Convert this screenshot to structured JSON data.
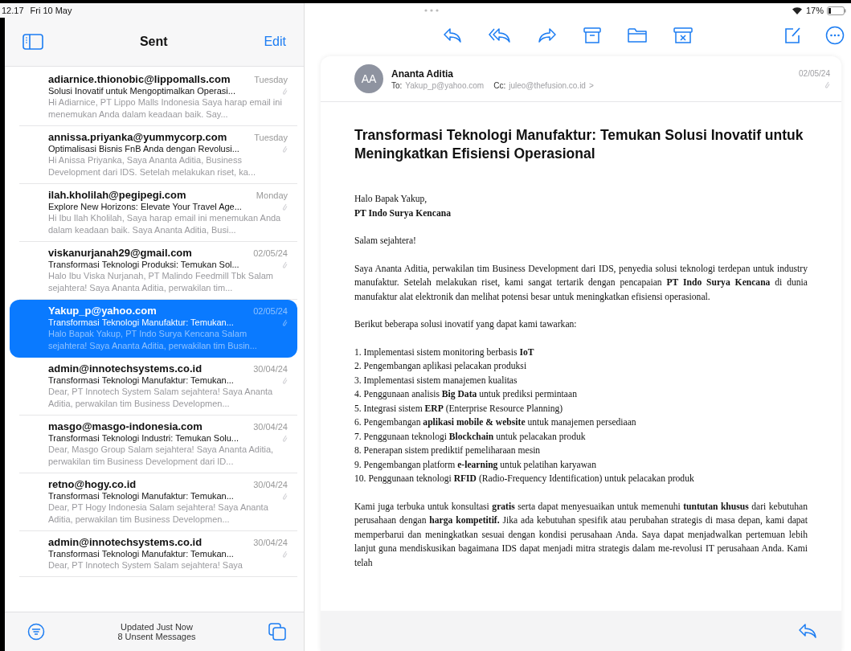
{
  "status_bar": {
    "time": "12.17",
    "date": "Fri 10 May",
    "battery": "17%"
  },
  "mailbox": {
    "title": "Sent",
    "edit": "Edit",
    "messages": [
      {
        "from": "adiarnice.thionobic@lippomalls.com",
        "date": "Tuesday",
        "subject": "Solusi Inovatif untuk Mengoptimalkan Operasi...",
        "preview": "Hi Adiarnice, PT Lippo Malls Indonesia Saya harap email ini menemukan Anda dalam keadaan baik. Say...",
        "selected": false
      },
      {
        "from": "annissa.priyanka@yummycorp.com",
        "date": "Tuesday",
        "subject": "Optimalisasi Bisnis FnB Anda dengan Revolusi...",
        "preview": "Hi Anissa Priyanka, Saya Ananta Aditia, Business Development dari IDS. Setelah melakukan riset, ka...",
        "selected": false
      },
      {
        "from": "ilah.kholilah@pegipegi.com",
        "date": "Monday",
        "subject": "Explore New Horizons: Elevate Your Travel Age...",
        "preview": "Hi Ibu Ilah Kholilah, Saya harap email ini menemukan Anda dalam keadaan baik. Saya Ananta Aditia, Busi...",
        "selected": false
      },
      {
        "from": "viskanurjanah29@gmail.com",
        "date": "02/05/24",
        "subject": "Transformasi Teknologi Produksi: Temukan Sol...",
        "preview": "Halo Ibu Viska Nurjanah, PT Malindo Feedmill Tbk Salam sejahtera! Saya Ananta Aditia, perwakilan tim...",
        "selected": false
      },
      {
        "from": "Yakup_p@yahoo.com",
        "date": "02/05/24",
        "subject": "Transformasi Teknologi Manufaktur: Temukan...",
        "preview": "Halo Bapak Yakup, PT Indo Surya Kencana Salam sejahtera! Saya Ananta Aditia, perwakilan tim Busin...",
        "selected": true
      },
      {
        "from": "admin@innotechsystems.co.id",
        "date": "30/04/24",
        "subject": "Transformasi Teknologi Manufaktur: Temukan...",
        "preview": "Dear, PT Innotech System Salam sejahtera! Saya Ananta Aditia, perwakilan tim Business Developmen...",
        "selected": false
      },
      {
        "from": "masgo@masgo-indonesia.com",
        "date": "30/04/24",
        "subject": "Transformasi Teknologi Industri: Temukan Solu...",
        "preview": "Dear, Masgo Group Salam sejahtera! Saya Ananta Aditia, perwakilan tim Business Development dari ID...",
        "selected": false
      },
      {
        "from": "retno@hogy.co.id",
        "date": "30/04/24",
        "subject": "Transformasi Teknologi Manufaktur: Temukan...",
        "preview": "Dear, PT Hogy Indonesia Salam sejahtera! Saya Ananta Aditia, perwakilan tim Business Developmen...",
        "selected": false
      },
      {
        "from": "admin@innotechsystems.co.id",
        "date": "30/04/24",
        "subject": "Transformasi Teknologi Manufaktur: Temukan...",
        "preview": "Dear, PT Innotech System Salam sejahtera! Saya",
        "selected": false
      }
    ],
    "footer": {
      "line1": "Updated Just Now",
      "line2": "8 Unsent Messages"
    }
  },
  "message": {
    "initials": "AA",
    "sender": "Ananta Aditia",
    "to_label": "To:",
    "to": "Yakup_p@yahoo.com",
    "cc_label": "Cc:",
    "cc": "juleo@thefusion.co.id",
    "chevron": ">",
    "date": "02/05/24",
    "subject": "Transformasi Teknologi Manufaktur: Temukan Solusi Inovatif untuk Meningkatkan Efisiensi Operasional",
    "greeting": "Halo Bapak Yakup,",
    "company": "PT Indo Surya Kencana",
    "salutation": "Salam sejahtera!",
    "intro": "Saya Ananta Aditia, perwakilan tim Business Development dari IDS, penyedia solusi teknologi terdepan untuk industry manufaktur. Setelah melakukan riset, kami sangat tertarik dengan pencapaian **PT Indo Surya Kencana** di dunia manufaktur alat elektronik dan melihat potensi besar untuk meningkatkan efisiensi operasional.",
    "list_intro": "Berikut beberapa solusi inovatif yang dapat kami tawarkan:",
    "solutions": [
      "1. Implementasi sistem monitoring berbasis **IoT**",
      "2. Pengembangan aplikasi pelacakan produksi",
      "3. Implementasi sistem manajemen kualitas",
      "4. Penggunaan analisis **Big Data** untuk prediksi permintaan",
      "5. Integrasi sistem **ERP** (Enterprise Resource Planning)",
      "6. Pengembangan **aplikasi mobile & website** untuk manajemen persediaan",
      "7. Penggunaan teknologi **Blockchain** untuk pelacakan produk",
      "8. Penerapan sistem prediktif pemeliharaan mesin",
      "9. Pengembangan platform **e-learning** untuk pelatihan karyawan",
      "10. Penggunaan teknologi **RFID** (Radio-Frequency Identification) untuk pelacakan produk"
    ],
    "closing": "Kami juga terbuka untuk konsultasi **gratis** serta dapat menyesuaikan untuk memenuhi **tuntutan khusus** dari kebutuhan perusahaan dengan **harga kompetitif.** Jika ada kebutuhan spesifik atau perubahan strategis di masa depan, kami dapat  memperbarui dan meningkatkan sesuai dengan kondisi perusahaan Anda. Saya dapat menjadwalkan pertemuan lebih lanjut guna mendiskusikan bagaimana IDS dapat menjadi mitra strategis dalam me-revolusi IT perusahaan Anda. Kami telah"
  }
}
